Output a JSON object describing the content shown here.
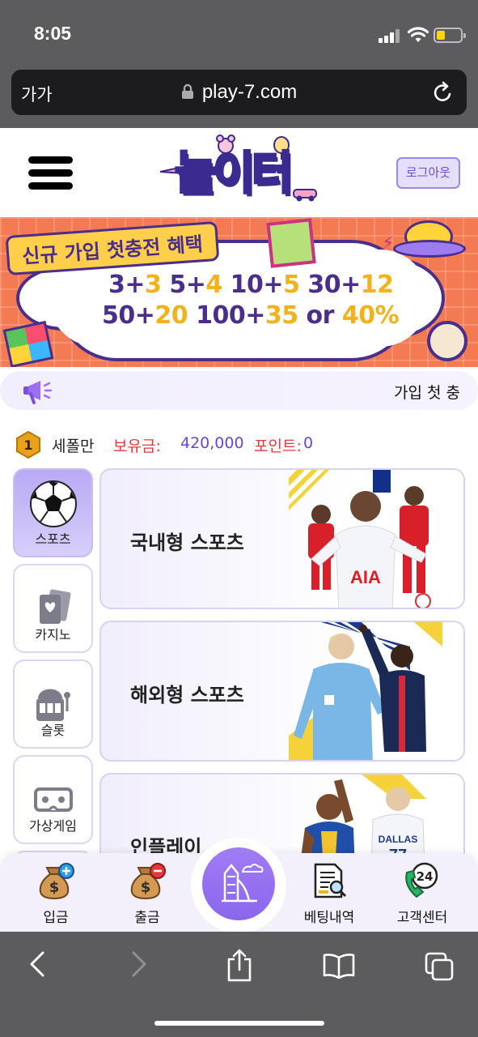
{
  "status_bar": {
    "time": "8:05"
  },
  "browser": {
    "text_size_label": "가가",
    "url": "play-7.com"
  },
  "header": {
    "logo_text": "놀이터",
    "logout_label": "로그아웃"
  },
  "banner": {
    "title": "신규 가입 첫충전 혜택",
    "line1": [
      {
        "t": "3+"
      },
      {
        "t": "3",
        "hl": true
      },
      {
        "t": " 5+"
      },
      {
        "t": "4",
        "hl": true
      },
      {
        "t": " 10+"
      },
      {
        "t": "5",
        "hl": true
      },
      {
        "t": " 30+"
      },
      {
        "t": "12",
        "hl": true
      }
    ],
    "line2": [
      {
        "t": "50+"
      },
      {
        "t": "20",
        "hl": true
      },
      {
        "t": " 100+"
      },
      {
        "t": "35",
        "hl": true
      },
      {
        "t": " or "
      },
      {
        "t": "40%",
        "hl": true
      }
    ]
  },
  "notice": {
    "text": "가입 첫 충"
  },
  "user": {
    "name": "세폴만",
    "level": "1",
    "balance_label": "보유금:",
    "balance": "420,000",
    "points_label": "포인트:",
    "points": "0"
  },
  "categories": [
    {
      "label": "스포츠",
      "icon": "soccer-ball-icon",
      "active": true
    },
    {
      "label": "카지노",
      "icon": "playing-cards-icon",
      "active": false
    },
    {
      "label": "슬롯",
      "icon": "slot-machine-icon",
      "active": false
    },
    {
      "label": "가상게임",
      "icon": "vr-headset-icon",
      "active": false
    }
  ],
  "games": [
    {
      "title": "국내형 스포츠",
      "image": "soccer-players-image"
    },
    {
      "title": "해외형 스포츠",
      "image": "football-stars-image"
    },
    {
      "title": "인플레이",
      "image": "basketball-players-image"
    }
  ],
  "bottom_nav": [
    {
      "label": "입금",
      "icon": "deposit-money-bag-icon"
    },
    {
      "label": "출금",
      "icon": "withdraw-money-bag-icon"
    },
    {
      "label": "",
      "icon": "playground-slide-icon"
    },
    {
      "label": "베팅내역",
      "icon": "betting-history-icon"
    },
    {
      "label": "고객센터",
      "icon": "customer-center-24-icon"
    }
  ],
  "colors": {
    "accent": "#8a66ec",
    "red": "#e8373b",
    "purple_text": "#6a46d4",
    "banner_bg": "#f47a52"
  }
}
